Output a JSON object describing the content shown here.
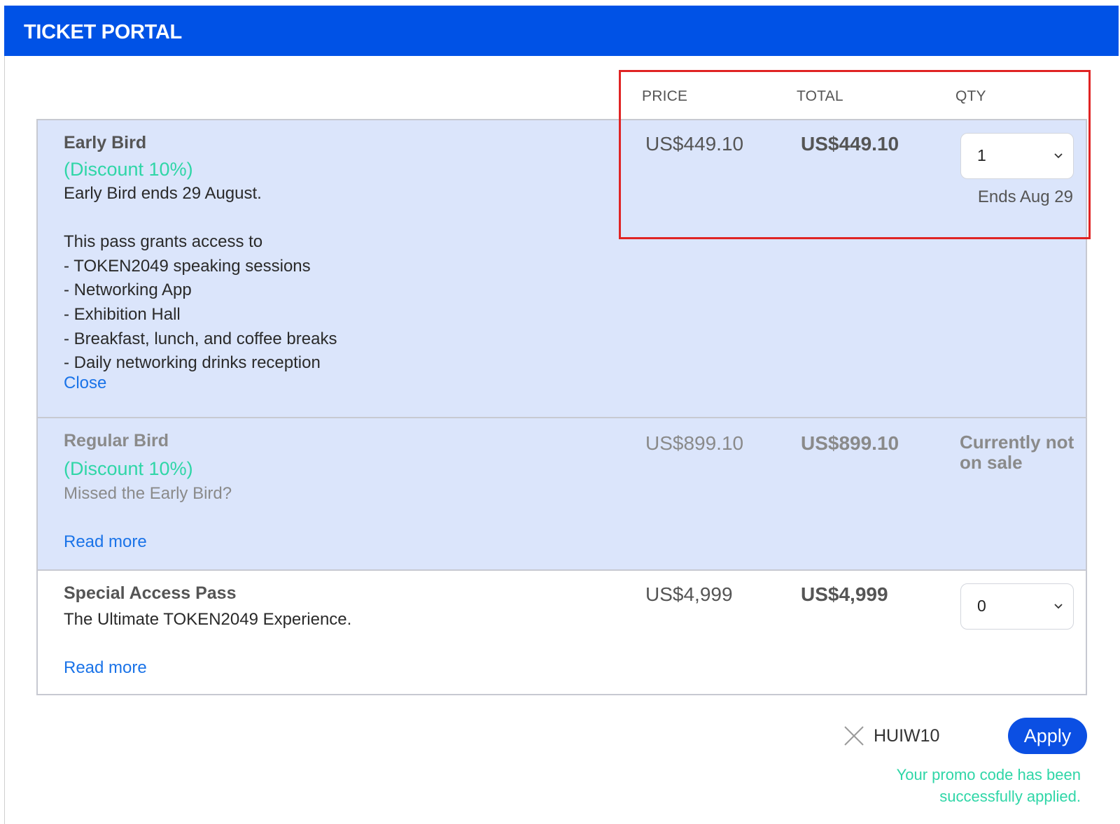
{
  "app": {
    "title": "TICKET PORTAL"
  },
  "columns": {
    "price": "PRICE",
    "total": "TOTAL",
    "qty": "QTY"
  },
  "tickets": [
    {
      "name": "Early Bird",
      "discount": "(Discount 10%)",
      "description": "Early Bird ends 29 August.\n\nThis pass grants access to\n- TOKEN2049 speaking sessions\n- Networking App\n- Exhibition Hall\n- Breakfast, lunch, and coffee breaks\n- Daily networking drinks reception",
      "link": "Close",
      "price": "US$449.10",
      "total": "US$449.10",
      "qty": "1",
      "qty_note": "Ends Aug 29"
    },
    {
      "name": "Regular Bird",
      "discount": "(Discount 10%)",
      "description": "Missed the Early Bird?",
      "link": "Read more",
      "price": "US$899.10",
      "total": "US$899.10",
      "status": "Currently not on sale"
    },
    {
      "name": "Special Access Pass",
      "description": "The Ultimate TOKEN2049 Experience.",
      "link": "Read more",
      "price": "US$4,999",
      "total": "US$4,999",
      "qty": "0"
    }
  ],
  "promo": {
    "code": "HUIW10",
    "apply_label": "Apply",
    "message": "Your promo code has been successfully applied."
  },
  "colors": {
    "header": "#0052e6",
    "row_highlight": "#dbe5fb",
    "discount": "#2fd6a7",
    "link": "#1a73e8",
    "apply_button": "#0b4fe3",
    "annotation_box": "#e02424"
  },
  "icons": {
    "select_chevron": "chevron-down-icon",
    "promo_clear": "close-icon"
  }
}
